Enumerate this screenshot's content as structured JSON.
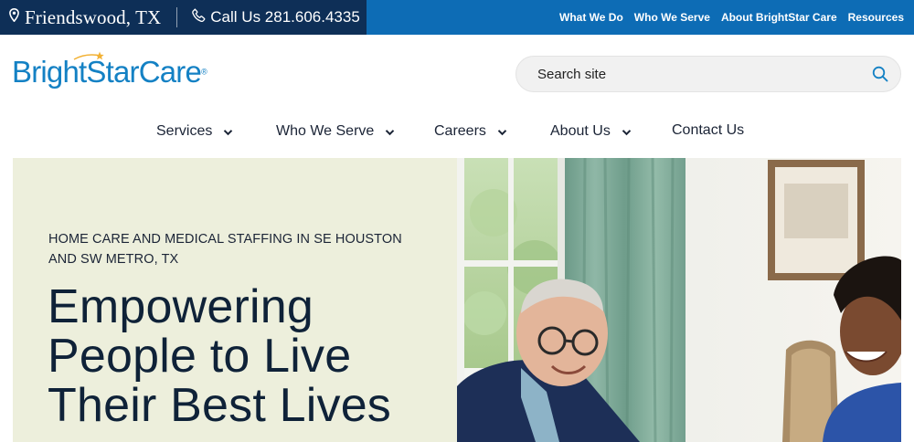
{
  "topbar": {
    "location": "Friendswood, TX",
    "phone_label": "Call Us 281.606.4335",
    "links": [
      "What We Do",
      "Who We Serve",
      "About BrightStar Care",
      "Resources"
    ]
  },
  "header": {
    "logo_text": "BrightStarCare",
    "logo_mark": "®",
    "search": {
      "placeholder": "Search site"
    }
  },
  "nav": {
    "items": [
      {
        "label": "Services",
        "dropdown": true
      },
      {
        "label": "Who We Serve",
        "dropdown": true
      },
      {
        "label": "Careers",
        "dropdown": true
      },
      {
        "label": "About Us",
        "dropdown": true
      },
      {
        "label": "Contact Us",
        "dropdown": false
      }
    ]
  },
  "hero": {
    "eyebrow": "HOME CARE AND MEDICAL STAFFING IN SE HOUSTON AND SW METRO, TX",
    "headline": "Empowering People to Live Their Best Lives"
  },
  "colors": {
    "topbar_dark": "#0e2f57",
    "topbar_blue": "#0d6cb5",
    "brand_blue": "#1481c4",
    "star_gold": "#f2b134",
    "hero_bg": "#edefdc",
    "text_dark": "#0f2238"
  },
  "icons": [
    "location-pin-icon",
    "phone-icon",
    "search-icon",
    "chevron-down-icon",
    "star-icon"
  ]
}
